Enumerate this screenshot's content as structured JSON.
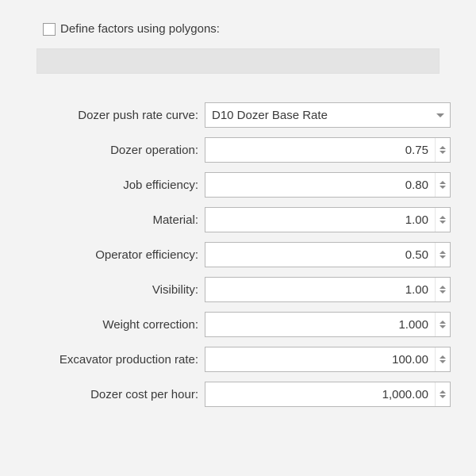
{
  "checkbox_label": "Define factors using polygons:",
  "fields": {
    "push_rate": {
      "label": "Dozer push rate curve:",
      "value": "D10 Dozer Base Rate"
    },
    "operation": {
      "label": "Dozer operation:",
      "value": "0.75"
    },
    "job_eff": {
      "label": "Job efficiency:",
      "value": "0.80"
    },
    "material": {
      "label": "Material:",
      "value": "1.00"
    },
    "op_eff": {
      "label": "Operator efficiency:",
      "value": "0.50"
    },
    "visibility": {
      "label": "Visibility:",
      "value": "1.00"
    },
    "weight": {
      "label": "Weight correction:",
      "value": "1.000"
    },
    "excavator": {
      "label": "Excavator production rate:",
      "value": "100.00"
    },
    "cost": {
      "label": "Dozer cost per hour:",
      "value": "1,000.00"
    }
  }
}
